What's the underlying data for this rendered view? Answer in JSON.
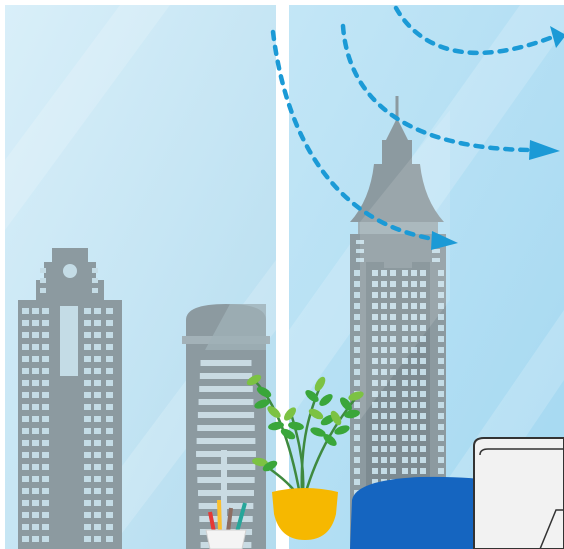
{
  "scene": {
    "subject": "office-window-city-view",
    "colors": {
      "sky_light": "#d6eef8",
      "sky": "#b9e2f5",
      "sky_deep": "#a6daf2",
      "window_frame": "#ffffff",
      "building": "#8c9aa0",
      "building_dark": "#7d8b91",
      "building_window": "#c4dce6",
      "glass_tint": "#d3e8f0",
      "arrow": "#1b9ad6",
      "leaf": "#3aa63a",
      "leaf_light": "#7cc243",
      "stem": "#3f8a3f",
      "pot": "#f6b800",
      "chair": "#1565c0",
      "monitor": "#f2f2f2",
      "monitor_outline": "#333333",
      "cup": "#f4f4f4",
      "pencil_red": "#e53935",
      "pencil_yellow": "#fbc02d",
      "pencil_teal": "#26a69a",
      "pencil_brown": "#8d6e63"
    },
    "icons": [
      "window",
      "skyscraper",
      "dashed-arrow",
      "potted-plant",
      "pencil-cup",
      "office-chair",
      "computer-monitor"
    ]
  }
}
